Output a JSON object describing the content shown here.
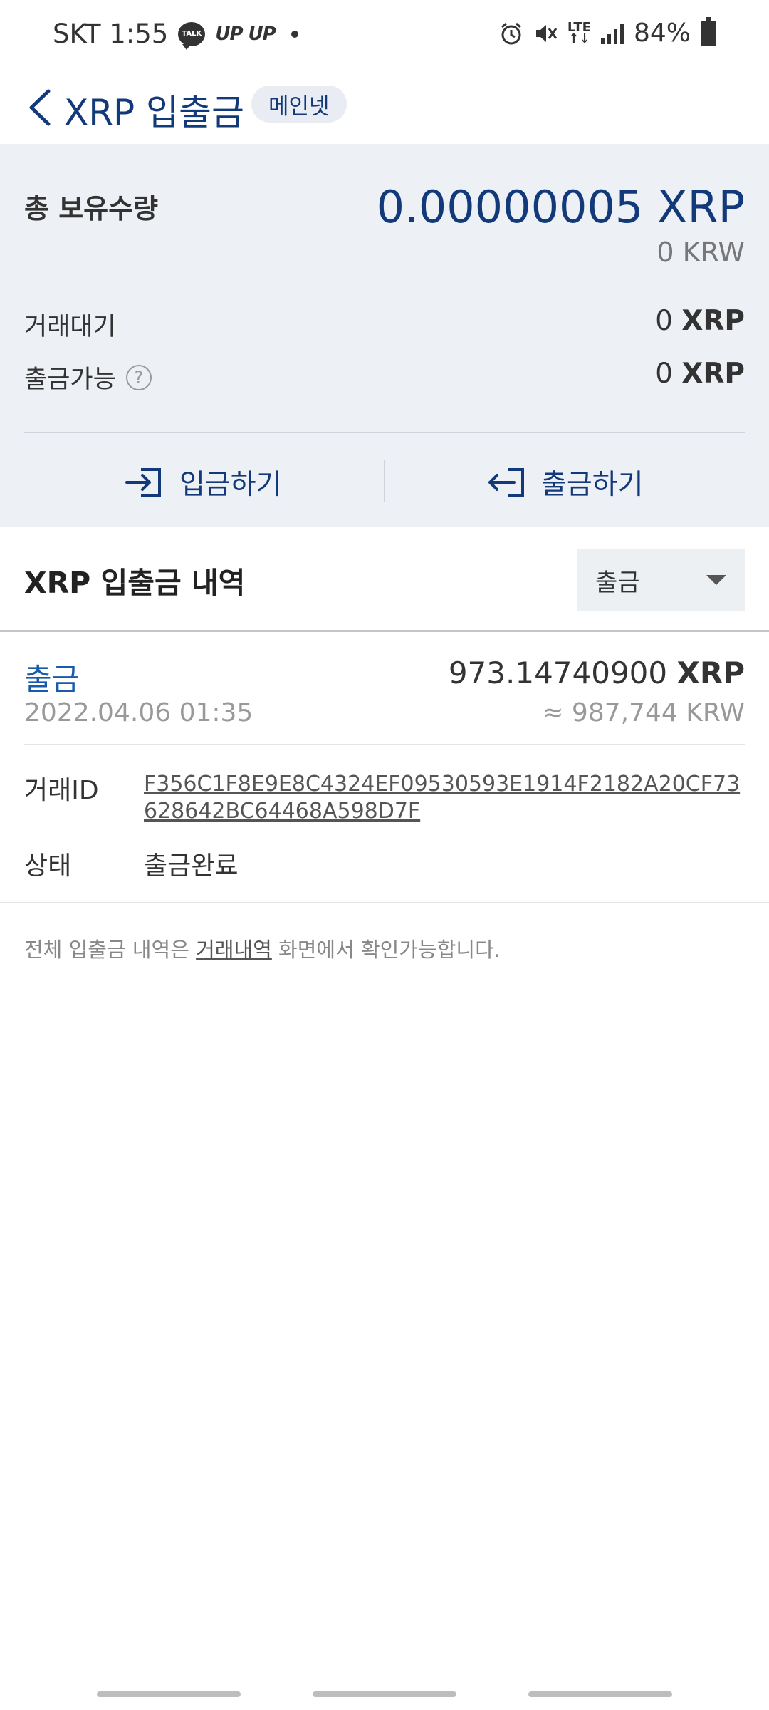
{
  "status_bar": {
    "carrier_time": "SKT 1:55",
    "talk_label": "TALK",
    "upup": "UP UP",
    "network": "LTE",
    "battery": "84%"
  },
  "header": {
    "title": "XRP 입출금",
    "badge": "메인넷"
  },
  "summary": {
    "total_label": "총 보유수량",
    "total_value": "0.00000005 XRP",
    "total_krw": "0 KRW",
    "pending_label": "거래대기",
    "pending_amount": "0",
    "pending_unit": "XRP",
    "available_label": "출금가능",
    "available_amount": "0",
    "available_unit": "XRP",
    "help_glyph": "?",
    "deposit_label": "입금하기",
    "withdraw_label": "출금하기"
  },
  "history": {
    "title": "XRP 입출금 내역",
    "filter_value": "출금"
  },
  "transaction": {
    "type": "출금",
    "date": "2022.04.06 01:35",
    "amount": "973.14740900",
    "unit": "XRP",
    "krw": "≈ 987,744 KRW",
    "txid_label": "거래ID",
    "txid": "F356C1F8E9E8C4324EF09530593E1914F2182A20CF73628642BC64468A598D7F",
    "status_label": "상태",
    "status_value": "출금완료"
  },
  "note": {
    "prefix": "전체 입출금 내역은 ",
    "link": "거래내역",
    "suffix": " 화면에서 확인가능합니다."
  },
  "colors": {
    "accent_navy": "#123a7a",
    "link_blue": "#1a5aab",
    "summary_bg": "#edf0f5"
  },
  "icons": {
    "back": "chevron-left-icon",
    "deposit": "deposit-arrow-icon",
    "withdraw": "withdraw-arrow-icon",
    "help": "help-circle-icon",
    "filter": "dropdown-arrow-icon"
  }
}
